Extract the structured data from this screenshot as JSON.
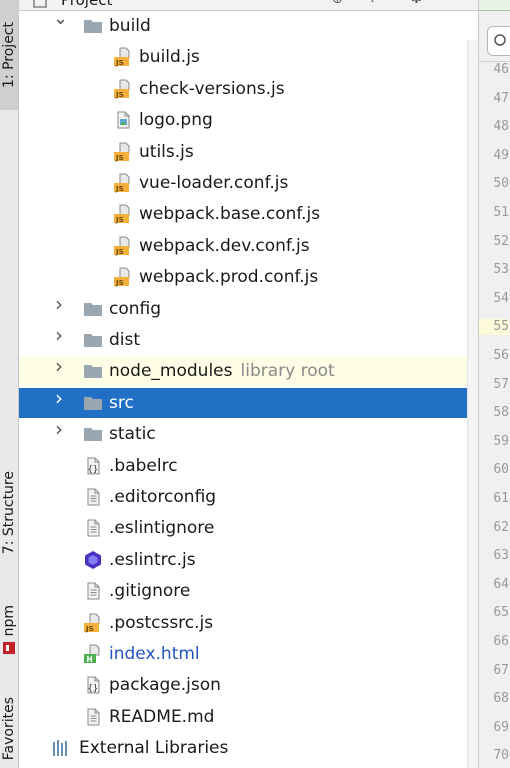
{
  "left_strip": {
    "project_tab": "1: Project",
    "structure_tab": "7: Structure",
    "npm_tab": "npm",
    "favorites_tab": "Favorites"
  },
  "header": {
    "title": "Project"
  },
  "tree": {
    "rows": [
      {
        "label": "build",
        "type": "folder",
        "expanded": true
      },
      {
        "label": "build.js",
        "type": "js"
      },
      {
        "label": "check-versions.js",
        "type": "js"
      },
      {
        "label": "logo.png",
        "type": "image"
      },
      {
        "label": "utils.js",
        "type": "js"
      },
      {
        "label": "vue-loader.conf.js",
        "type": "js"
      },
      {
        "label": "webpack.base.conf.js",
        "type": "js"
      },
      {
        "label": "webpack.dev.conf.js",
        "type": "js"
      },
      {
        "label": "webpack.prod.conf.js",
        "type": "js"
      },
      {
        "label": "config",
        "type": "folder"
      },
      {
        "label": "dist",
        "type": "folder"
      },
      {
        "label": "node_modules",
        "type": "folder",
        "hint": "library root"
      },
      {
        "label": "src",
        "type": "folder",
        "selected": true
      },
      {
        "label": "static",
        "type": "folder"
      },
      {
        "label": ".babelrc",
        "type": "json"
      },
      {
        "label": ".editorconfig",
        "type": "text"
      },
      {
        "label": ".eslintignore",
        "type": "text"
      },
      {
        "label": ".eslintrc.js",
        "type": "eslint"
      },
      {
        "label": ".gitignore",
        "type": "text"
      },
      {
        "label": ".postcssrc.js",
        "type": "js"
      },
      {
        "label": "index.html",
        "type": "html"
      },
      {
        "label": "package.json",
        "type": "json"
      },
      {
        "label": "README.md",
        "type": "text"
      },
      {
        "label": "External Libraries",
        "type": "libraries"
      }
    ]
  },
  "editor": {
    "line_numbers": [
      "46",
      "47",
      "48",
      "49",
      "50",
      "51",
      "52",
      "53",
      "54",
      "55",
      "56",
      "57",
      "58",
      "59",
      "60",
      "61",
      "62",
      "63",
      "64",
      "65",
      "66",
      "67",
      "68",
      "69",
      "70"
    ],
    "current_line": "55"
  },
  "colors": {
    "selection": "#2270c5",
    "library_row": "#fefde6",
    "folder": "#9aa7b0",
    "js_badge": "#f4af3d",
    "html_link": "#2455bd"
  }
}
